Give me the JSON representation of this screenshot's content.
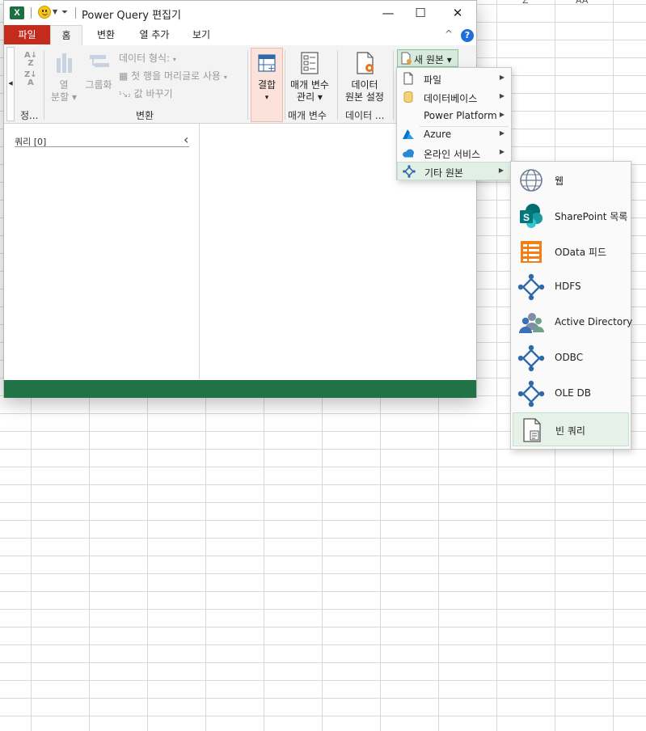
{
  "app": {
    "title": "Power Query 편집기",
    "excel_badge": "X"
  },
  "colors": {
    "file_tab": "#c42b1c",
    "status_bar": "#217346",
    "new_source_button": "#d6ebdd",
    "combine_button": "#fbe3dc",
    "help": "#1e6fd9",
    "sharepoint": "#038387",
    "odata": "#f57f17",
    "connector": "#2f6aa8"
  },
  "sheet": {
    "column_letters": [
      "Z",
      "AA"
    ]
  },
  "window_controls": {
    "minimize": "—",
    "maximize": "☐",
    "close": "✕"
  },
  "ribbon": {
    "file_tab": "파일",
    "tabs": [
      "홈",
      "변환",
      "열 추가",
      "보기"
    ],
    "collapse": "^",
    "help": "?",
    "sort_group_label": "정...",
    "transform_group": {
      "split_column_line1": "열",
      "split_column_line2": "분할",
      "group_by": "그룹화",
      "data_type": "데이터 형식:",
      "use_first_row": "첫 행을 머리글로 사용",
      "replace_values": "값 바꾸기",
      "label": "변환"
    },
    "combine": {
      "label": "결합",
      "caret": "▾"
    },
    "parameters_group": {
      "manage_line1": "매개 변수",
      "manage_line2": "관리 ▾",
      "label": "매개 변수"
    },
    "data_source_group": {
      "settings_line1": "데이터",
      "settings_line2": "원본 설정",
      "label": "데이터 ..."
    },
    "new_source": "새 원본 ▾"
  },
  "queries_pane": {
    "label": "쿼리 [0]",
    "collapse": "‹"
  },
  "new_source_menu": {
    "items": [
      {
        "label": "파일",
        "icon": "file-icon"
      },
      {
        "label": "데이터베이스",
        "icon": "database-icon"
      },
      {
        "label": "Power Platform",
        "icon": ""
      },
      {
        "label": "Azure",
        "icon": "azure-icon"
      },
      {
        "label": "온라인 서비스",
        "icon": "cloud-icon"
      },
      {
        "label": "기타 원본",
        "icon": "connector-icon"
      }
    ]
  },
  "other_sources_submenu": {
    "items": [
      {
        "label": "웹",
        "icon": "globe-icon"
      },
      {
        "label": "SharePoint 목록",
        "icon": "sharepoint-icon"
      },
      {
        "label": "OData 피드",
        "icon": "odata-icon"
      },
      {
        "label": "HDFS",
        "icon": "hdfs-icon"
      },
      {
        "label": "Active Directory",
        "icon": "active-directory-icon"
      },
      {
        "label": "ODBC",
        "icon": "odbc-icon"
      },
      {
        "label": "OLE DB",
        "icon": "oledb-icon"
      },
      {
        "label": "빈 쿼리",
        "icon": "blank-query-icon"
      }
    ]
  }
}
